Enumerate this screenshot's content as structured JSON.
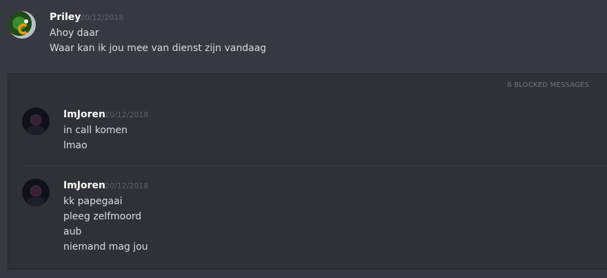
{
  "messages": [
    {
      "username": "Priley",
      "timestamp": "20/12/2018",
      "avatar_icon": "parrot-avatar",
      "lines": [
        "Ahoy daar",
        "Waar kan ik jou mee van dienst zijn vandaag"
      ]
    }
  ],
  "blocked": {
    "label": "6 BLOCKED MESSAGES",
    "messages": [
      {
        "username": "ImJoren",
        "timestamp": "20/12/2018",
        "avatar_icon": "dark-figure-avatar",
        "lines": [
          "in call komen",
          "lmao"
        ]
      },
      {
        "username": "ImJoren",
        "timestamp": "20/12/2018",
        "avatar_icon": "dark-figure-avatar",
        "lines": [
          "kk papegaai",
          "pleeg zelfmoord",
          "aub",
          "niemand mag jou"
        ]
      }
    ]
  },
  "colors": {
    "background": "#36393f",
    "blocked_background": "#2f3136",
    "username": "#ffffff",
    "text": "#dcddde",
    "timestamp": "#5d6066"
  }
}
